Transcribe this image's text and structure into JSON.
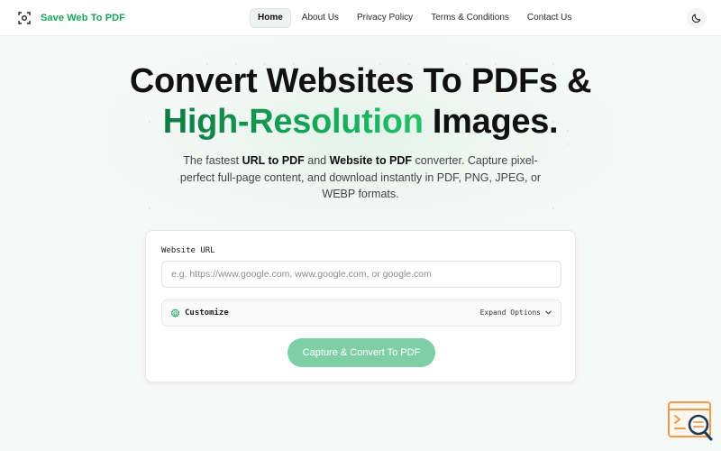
{
  "header": {
    "brand_name": "Save Web To PDF",
    "nav": [
      {
        "label": "Home",
        "active": true
      },
      {
        "label": "About Us"
      },
      {
        "label": "Privacy Policy"
      },
      {
        "label": "Terms & Conditions"
      },
      {
        "label": "Contact Us"
      }
    ],
    "theme_icon": "moon-icon"
  },
  "hero": {
    "title_line1": "Convert Websites To PDFs &",
    "title_line2_highlight": "High-Resolution",
    "title_line2_rest": " Images.",
    "subtitle_pre": "The fastest ",
    "subtitle_bold1": "URL to PDF",
    "subtitle_mid": " and ",
    "subtitle_bold2": "Website to PDF",
    "subtitle_post": " converter. Capture pixel-perfect full-page content, and download instantly in PDF, PNG, JPEG, or WEBP formats."
  },
  "form": {
    "url_label": "Website URL",
    "url_value": "",
    "url_placeholder": "e.g. https://www.google.com, www.google.com, or google.com",
    "customize_label": "Customize",
    "expand_label": "Expand Options",
    "submit_label": "Capture & Convert To PDF"
  },
  "colors": {
    "brand": "#17a65a",
    "button": "#7fcfa6",
    "corner_widget": "#f2994a"
  }
}
